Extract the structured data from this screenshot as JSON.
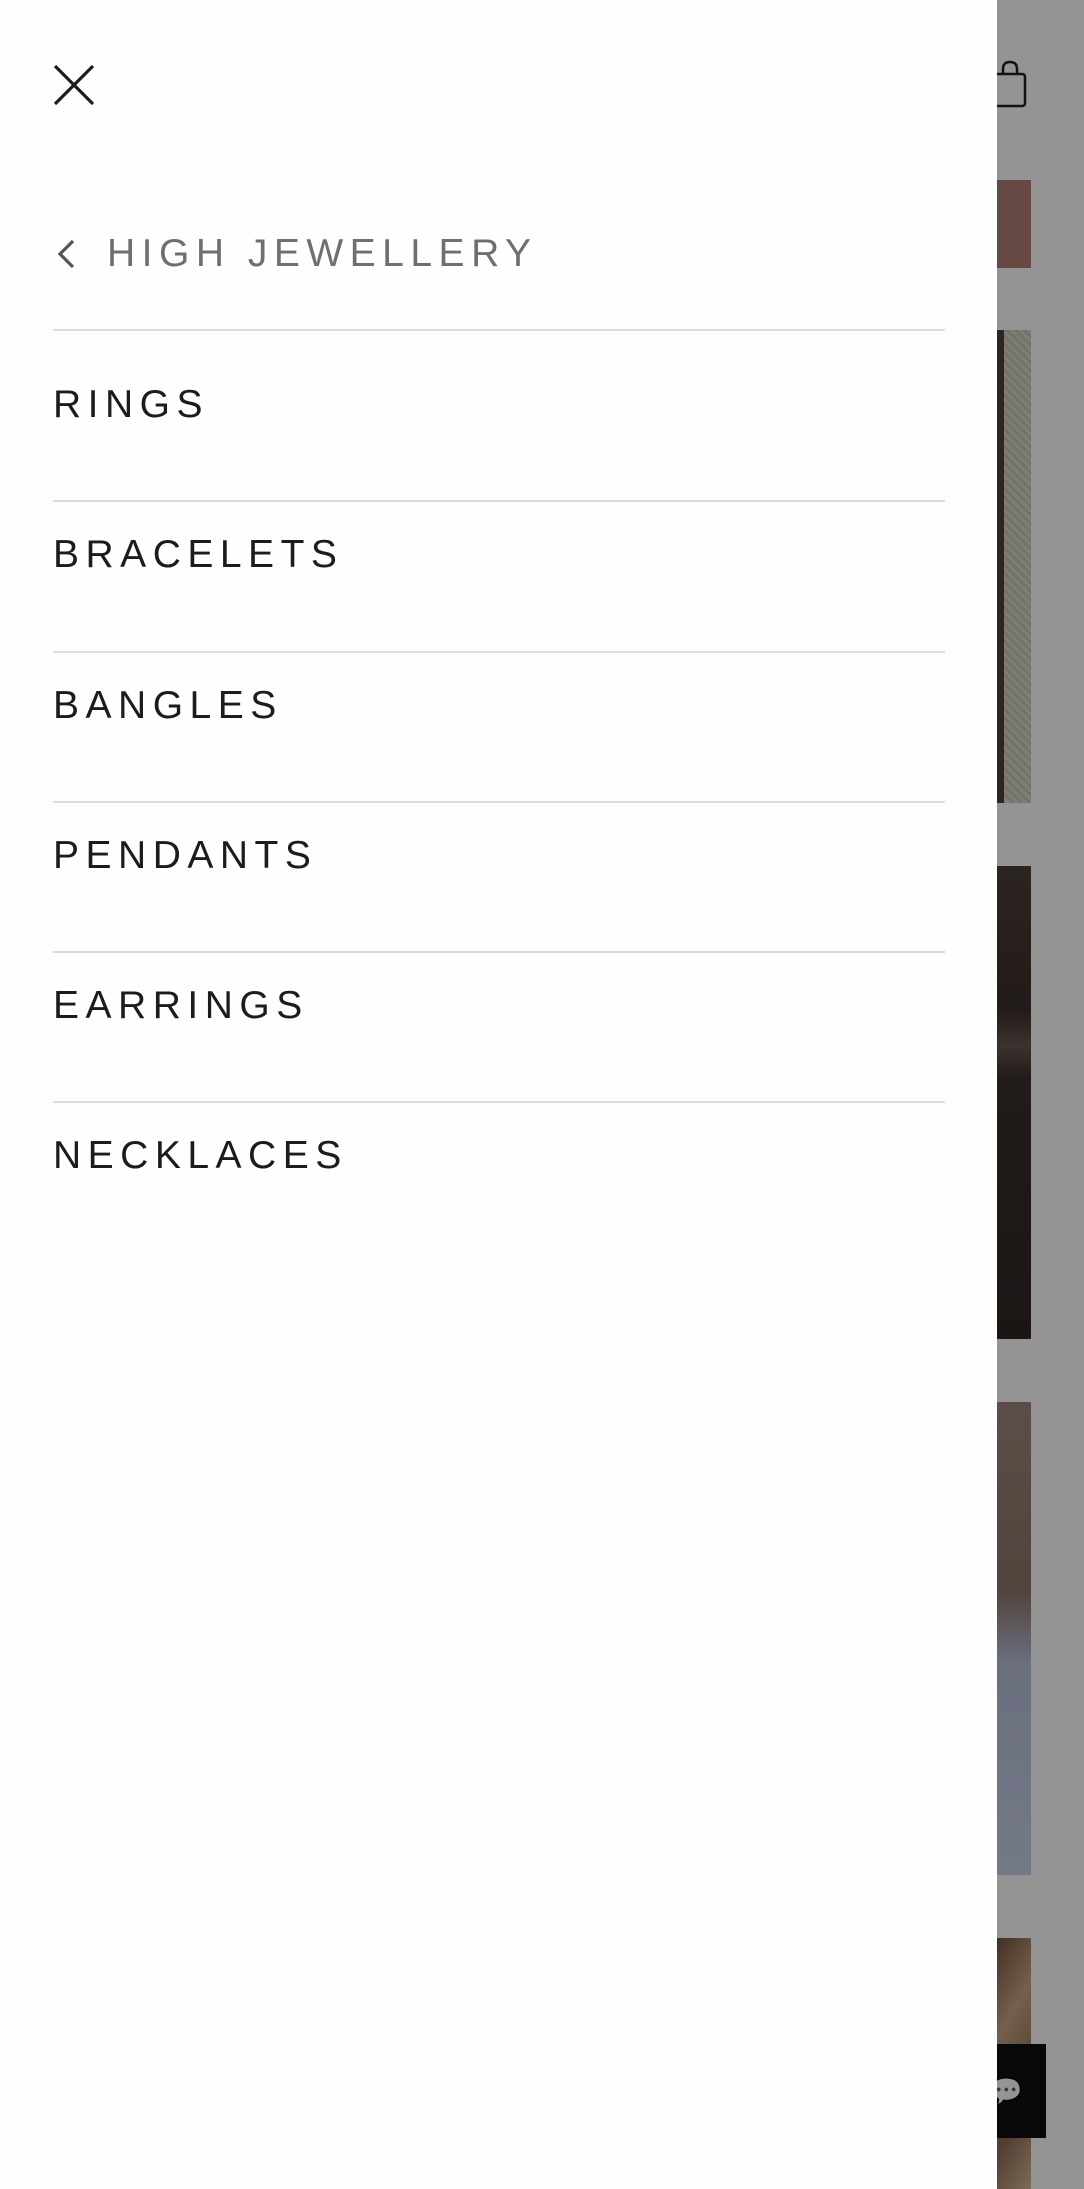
{
  "drawer": {
    "close_icon": "close-icon",
    "back": {
      "icon": "chevron-left-icon",
      "label": "HIGH JEWELLERY"
    },
    "items": [
      {
        "label": "RINGS"
      },
      {
        "label": "BRACELETS"
      },
      {
        "label": "BANGLES"
      },
      {
        "label": "PENDANTS"
      },
      {
        "label": "EARRINGS"
      },
      {
        "label": "NECKLACES"
      }
    ]
  },
  "background": {
    "cart_icon": "shopping-bag-icon",
    "chat_icon": "chat-icon"
  },
  "colors": {
    "drawer_bg": "#fefefe",
    "text": "#1c1c1c",
    "muted_text": "#6f6f6f",
    "divider": "#dcdcdc",
    "overlay": "rgba(0,0,0,0.42)"
  }
}
